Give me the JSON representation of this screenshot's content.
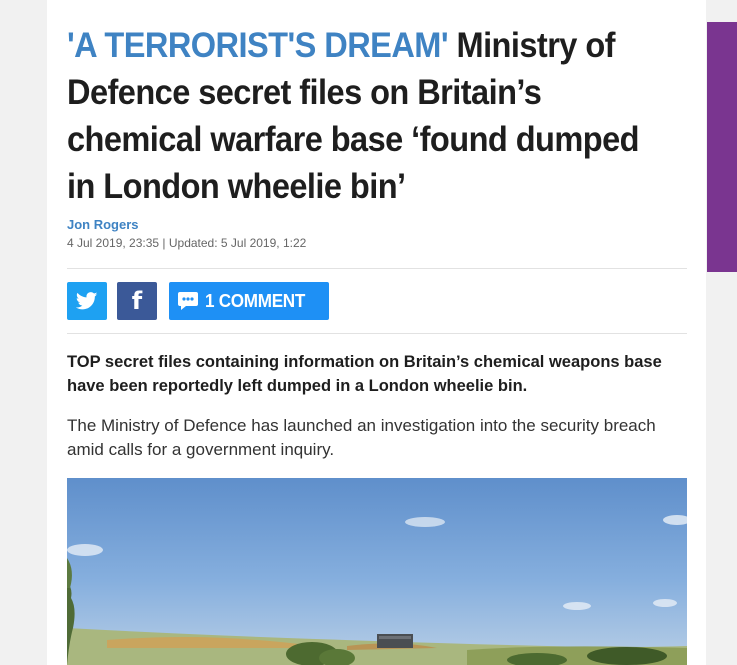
{
  "article": {
    "kicker": "'A TERRORIST'S DREAM'",
    "headline": "Ministry of Defence secret files on Britain’s chemical warfare base ‘found dumped in London wheelie bin’",
    "author": "Jon Rogers",
    "timestamp": "4 Jul 2019, 23:35 | Updated: 5 Jul 2019, 1:22",
    "lead": "TOP secret files containing information on Britain’s chemical weapons base have been reportedly left dumped in a London wheelie bin.",
    "body": "The Ministry of Defence has launched an investigation into the security breach amid calls for a government inquiry."
  },
  "share": {
    "twitter_icon": "twitter-icon",
    "facebook_icon": "facebook-icon",
    "facebook_glyph": "f",
    "comment_icon": "comment-bubble-icon",
    "comment_label": "1 COMMENT"
  },
  "image": {
    "subject": "landscape photo of military base with blue sky and fields"
  },
  "colors": {
    "kicker": "#3f83c3",
    "headline": "#1e1e1e",
    "twitter": "#1ea1f2",
    "facebook": "#3b5998",
    "comment": "#1e90f5",
    "ad_bar": "#7a3590",
    "page_bg": "#f1f1f1"
  }
}
